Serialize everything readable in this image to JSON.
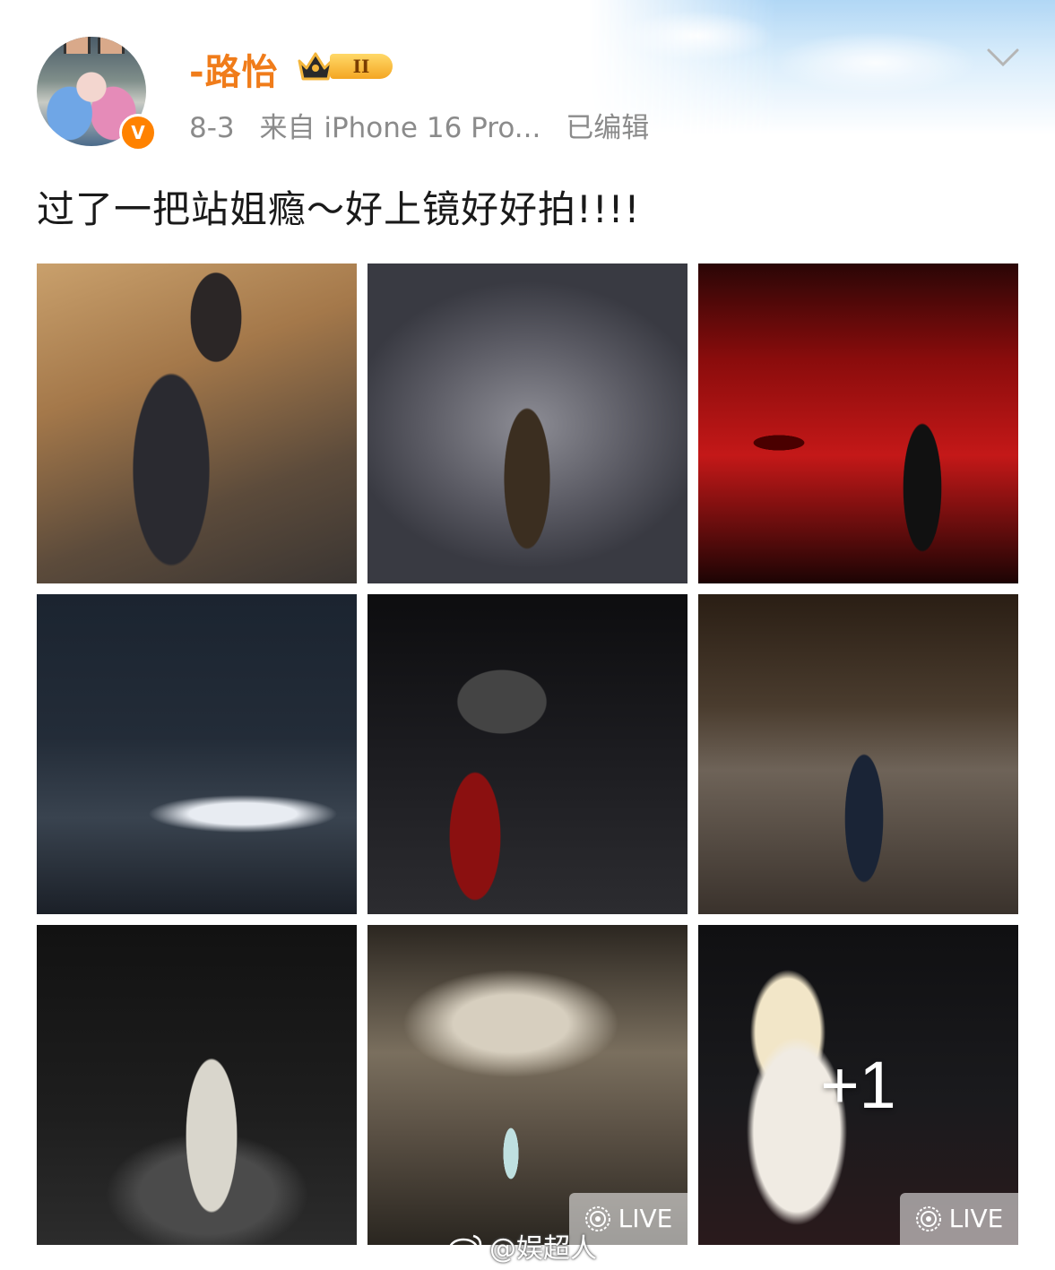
{
  "post": {
    "username": "-路怡",
    "vip_level": "II",
    "verified_mark": "V",
    "date": "8-3",
    "source": "来自 iPhone 16 Pro...",
    "edited": "已编辑",
    "text": "过了一把站姐瘾～好上镜好好拍!!!!"
  },
  "images": [
    {
      "name": "photo-1",
      "live": false
    },
    {
      "name": "photo-2",
      "live": false
    },
    {
      "name": "photo-3",
      "live": false
    },
    {
      "name": "photo-4",
      "live": false
    },
    {
      "name": "photo-5",
      "live": false
    },
    {
      "name": "photo-6",
      "live": false
    },
    {
      "name": "photo-7",
      "live": false
    },
    {
      "name": "photo-8",
      "live": true
    },
    {
      "name": "photo-9",
      "live": true
    }
  ],
  "live_label": "LIVE",
  "more_count": "+1",
  "watermark": "@娱超人",
  "colors": {
    "username": "#f07c1a",
    "verified": "#ff8200",
    "meta_text": "#8b8b8b",
    "body_text": "#1a1a1a"
  },
  "icons": [
    "crown-icon",
    "chevron-down-icon",
    "live-icon",
    "weibo-logo-icon",
    "verified-icon"
  ]
}
